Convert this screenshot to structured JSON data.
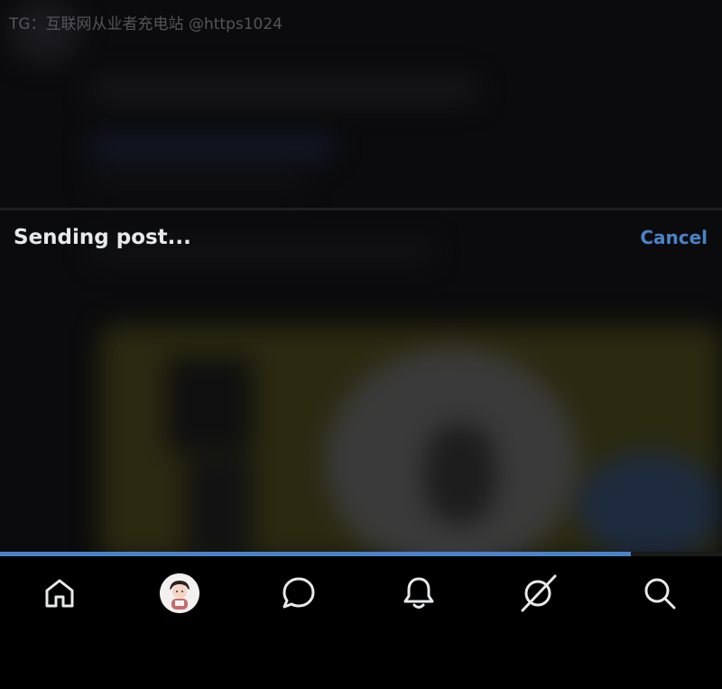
{
  "watermark": "TG：互联网从业者充电站 @https1024",
  "upload_banner": {
    "status_text": "Sending post...",
    "cancel_label": "Cancel"
  },
  "progress": {
    "fraction": 0.874
  },
  "bottom_nav": {
    "items": [
      {
        "name": "home",
        "icon": "home-icon"
      },
      {
        "name": "profile",
        "icon": "avatar"
      },
      {
        "name": "messages",
        "icon": "chat-bubble-icon"
      },
      {
        "name": "notifications",
        "icon": "bell-icon"
      },
      {
        "name": "explore",
        "icon": "slashed-circle-icon"
      },
      {
        "name": "search",
        "icon": "search-icon"
      }
    ]
  },
  "colors": {
    "accent": "#4a83c8",
    "background": "#000000",
    "text_primary": "#e7e9ea",
    "watermark": "#54545a"
  }
}
